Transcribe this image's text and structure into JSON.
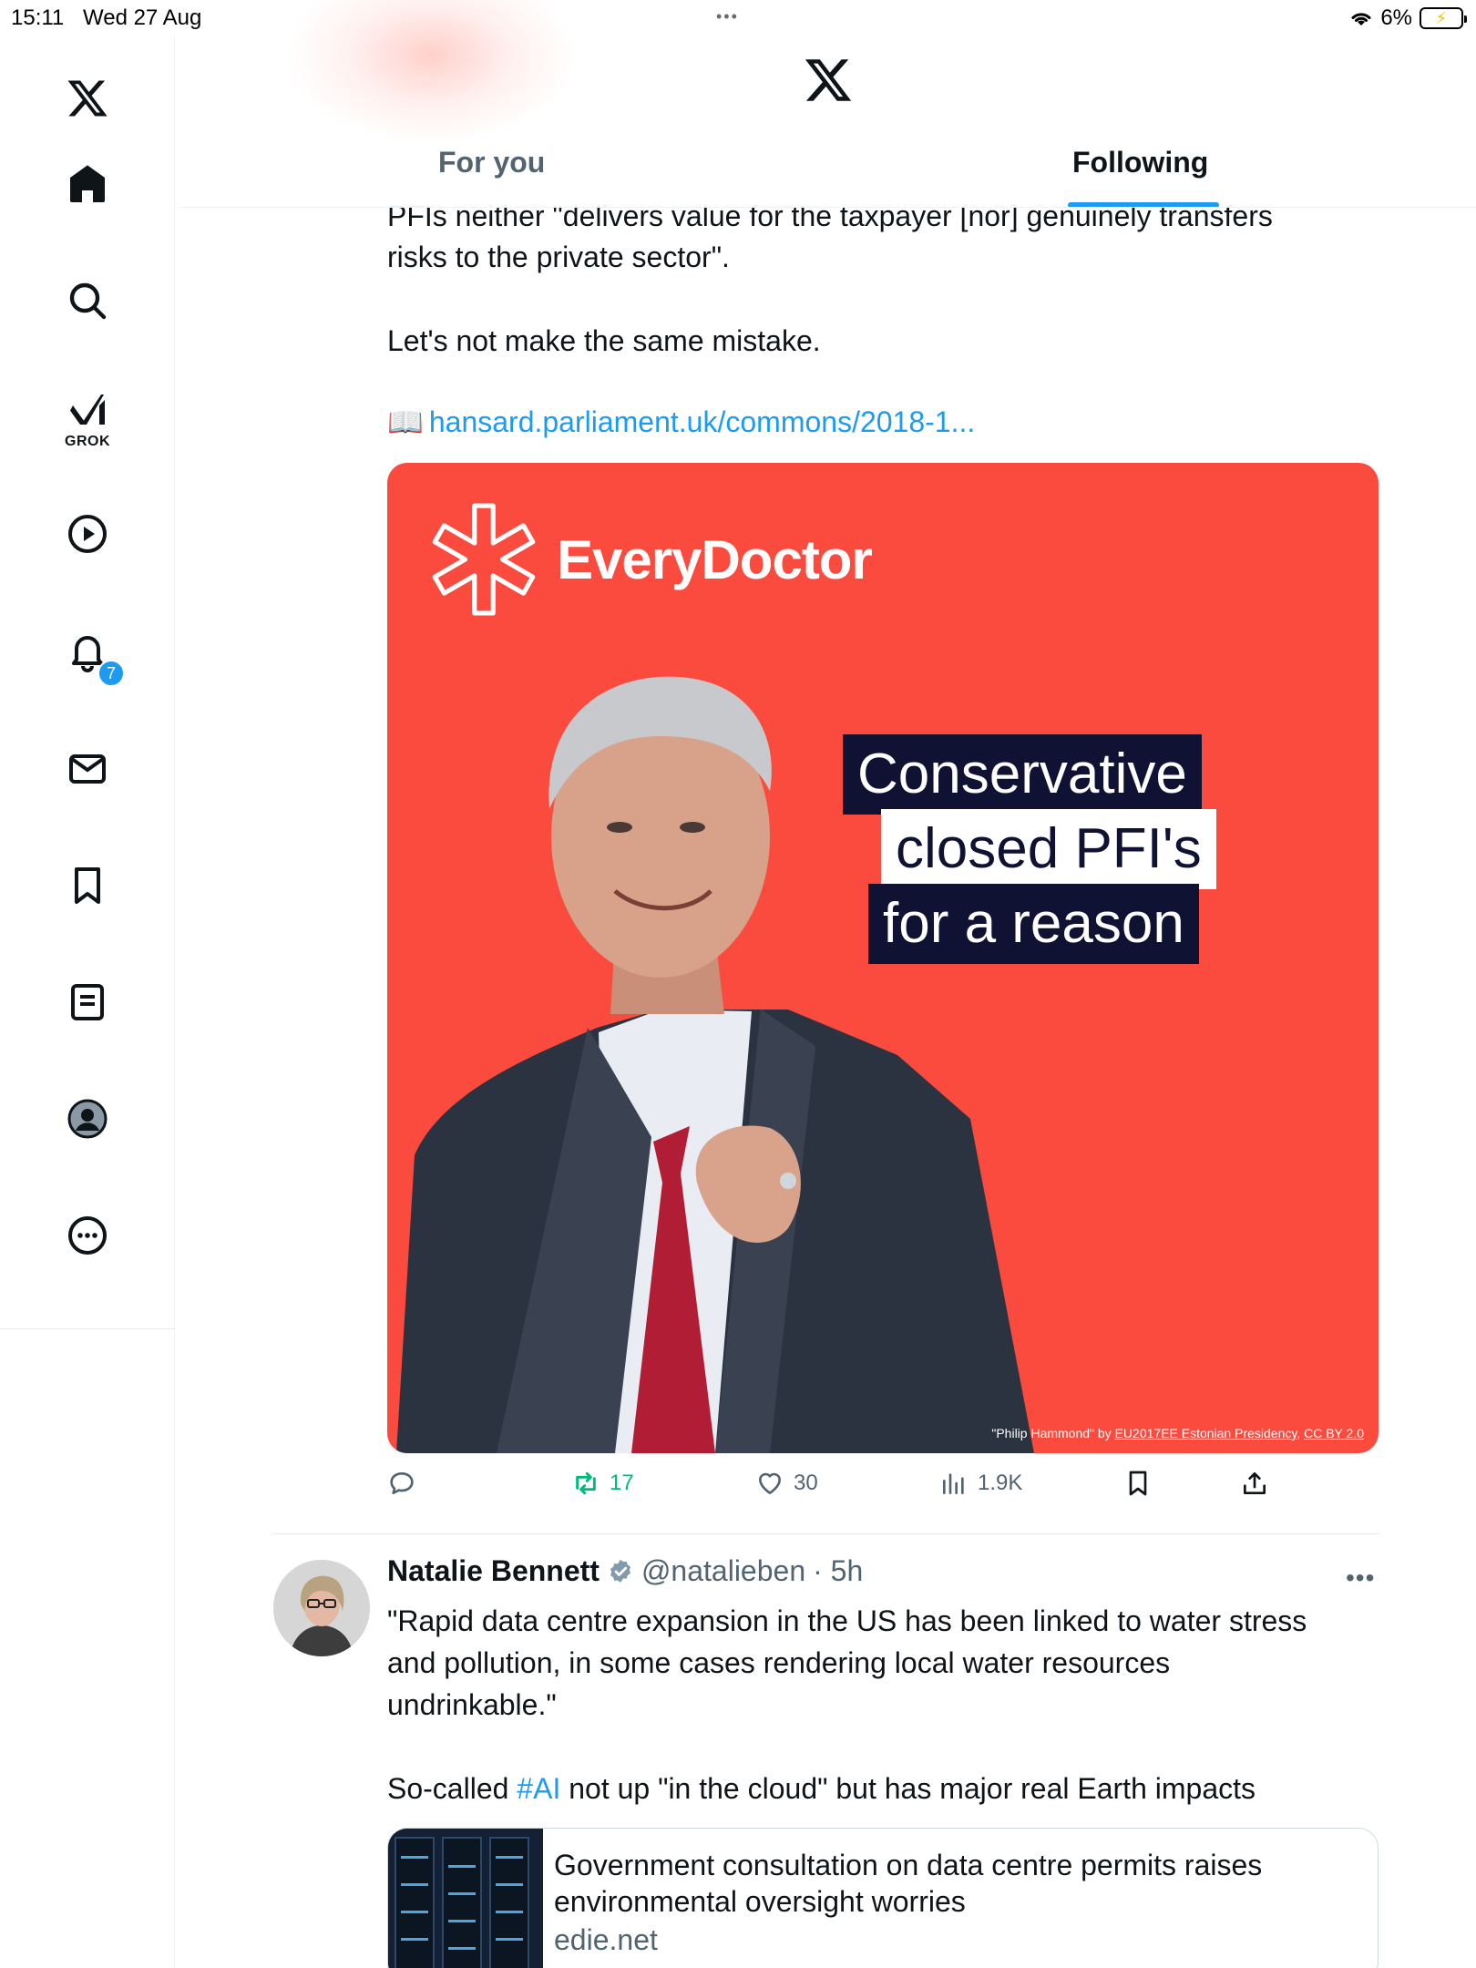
{
  "status_bar": {
    "time": "15:11",
    "date": "Wed 27 Aug",
    "more_dots": "•••",
    "battery_percent": "6%"
  },
  "header": {
    "tabs": [
      {
        "label": "For you",
        "active": false
      },
      {
        "label": "Following",
        "active": true
      }
    ]
  },
  "sidebar": {
    "grok_label": "GROK",
    "notifications_badge": "7",
    "items": [
      "x-logo",
      "home",
      "search",
      "grok",
      "videos",
      "notifications",
      "messages",
      "bookmarks",
      "lists",
      "profile",
      "more"
    ]
  },
  "tweet1": {
    "text_line1": "PFIs neither \"delivers value for the taxpayer [nor] genuinely transfers",
    "text_line2": "risks to the private sector\".",
    "text_para2": "Let's not make the same mistake.",
    "link_icon": "📖",
    "link_text": "hansard.parliament.uk/commons/2018-1...",
    "media": {
      "brand": "EveryDoctor",
      "slogan": [
        "Conservative",
        "closed PFI's",
        "for a reason"
      ],
      "credit_quote": "\"Philip Hammond\" by ",
      "credit_author": "EU2017EE Estonian Presidency",
      "credit_sep": ", ",
      "credit_license": "CC BY 2.0",
      "background_color": "#fa4b3e"
    },
    "actions": {
      "reply_count": "",
      "retweet_count": "17",
      "like_count": "30",
      "views_count": "1.9K"
    }
  },
  "tweet2": {
    "name": "Natalie Bennett",
    "handle": "@natalieben",
    "time": "· 5h",
    "more": "•••",
    "text_line1": "\"Rapid data centre expansion in the US has been linked to water stress",
    "text_line2": "and pollution, in some cases rendering local water resources",
    "text_line3": "undrinkable.\"",
    "text2_before": "So-called ",
    "hashtag": "#AI",
    "text2_after": " not up \"in the cloud\" but has major real Earth impacts",
    "card": {
      "title_line1": "Government consultation on data centre permits raises",
      "title_line2": "environmental oversight worries",
      "domain": "edie.net"
    }
  },
  "colors": {
    "accent": "#1d9bf0",
    "retweet_green": "#00ba7c",
    "muted": "#536471",
    "text": "#0f1419"
  }
}
